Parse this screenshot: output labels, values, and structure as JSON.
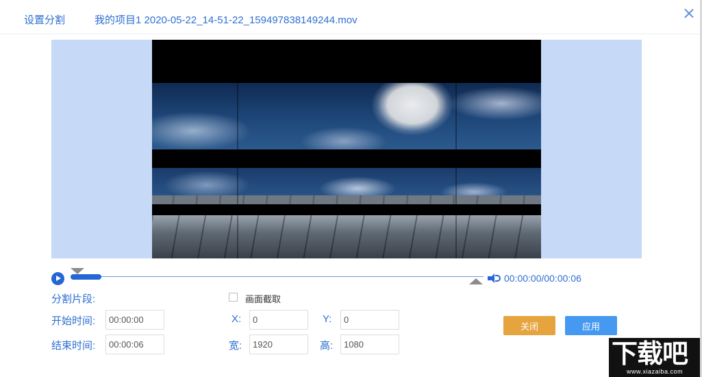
{
  "header": {
    "title": "设置分割",
    "file_name": "我的项目1 2020-05-22_14-51-22_159497838149244.mov"
  },
  "player": {
    "time": "00:00:00/00:00:06",
    "progress": 0.0
  },
  "form": {
    "segment_label": "分割片段:",
    "start_label": "开始时间:",
    "start_value": "00:00:00",
    "end_label": "结束时间:",
    "end_value": "00:00:06",
    "crop_label": "画面截取",
    "crop_checked": false,
    "x_label": "X:",
    "x_value": "0",
    "y_label": "Y:",
    "y_value": "0",
    "width_label": "宽:",
    "width_value": "1920",
    "height_label": "高:",
    "height_value": "1080"
  },
  "buttons": {
    "close": "关闭",
    "apply": "应用"
  },
  "watermark": {
    "main": "下载吧",
    "url": "www.xiazaiba.com"
  },
  "colors": {
    "accent": "#2466d6",
    "text": "#2d6fd1",
    "preview_bg": "#c6d9f7",
    "close_button": "#e5a43e",
    "apply_button": "#4599f0"
  },
  "icons": [
    "close-icon",
    "play-icon",
    "volume-icon",
    "trim-start-handle-icon",
    "trim-end-handle-icon"
  ]
}
